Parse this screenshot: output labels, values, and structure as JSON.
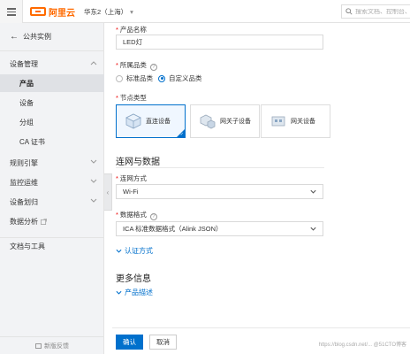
{
  "topbar": {
    "logo_text": "阿里云",
    "region": "华东2（上海）",
    "search_placeholder": "搜索文档、控制台、API、解"
  },
  "sidebar": {
    "back_label": "公共实例",
    "device_mgmt": "设备管理",
    "items": [
      "产品",
      "设备",
      "分组",
      "CA 证书"
    ],
    "rules_engine": "规则引擎",
    "ops": "监控运维",
    "device_plan": "设备划归",
    "data_analysis": "数据分析",
    "docs_tools": "文档与工具",
    "feedback": "新版反馈"
  },
  "form": {
    "product_name_label": "产品名称",
    "product_name_value": "LED灯",
    "category_label": "所属品类",
    "category_options": [
      "标准品类",
      "自定义品类"
    ],
    "category_selected": "自定义品类",
    "node_type_label": "节点类型",
    "node_types": [
      "直连设备",
      "网关子设备",
      "网关设备"
    ],
    "node_type_selected": "直连设备",
    "network_section": "连网与数据",
    "connect_label": "连网方式",
    "connect_value": "Wi-Fi",
    "data_format_label": "数据格式",
    "data_format_value": "ICA 标准数据格式（Alink JSON）",
    "auth_link": "认证方式",
    "more_info_section": "更多信息",
    "desc_link": "产品描述"
  },
  "footer": {
    "confirm": "确认",
    "cancel": "取消",
    "watermark": "https://blog.csdn.net/...  @51CTO博客"
  },
  "colors": {
    "brand": "#ff6a00",
    "primary": "#0070cc",
    "sidebar_bg": "#f2f3f5"
  }
}
